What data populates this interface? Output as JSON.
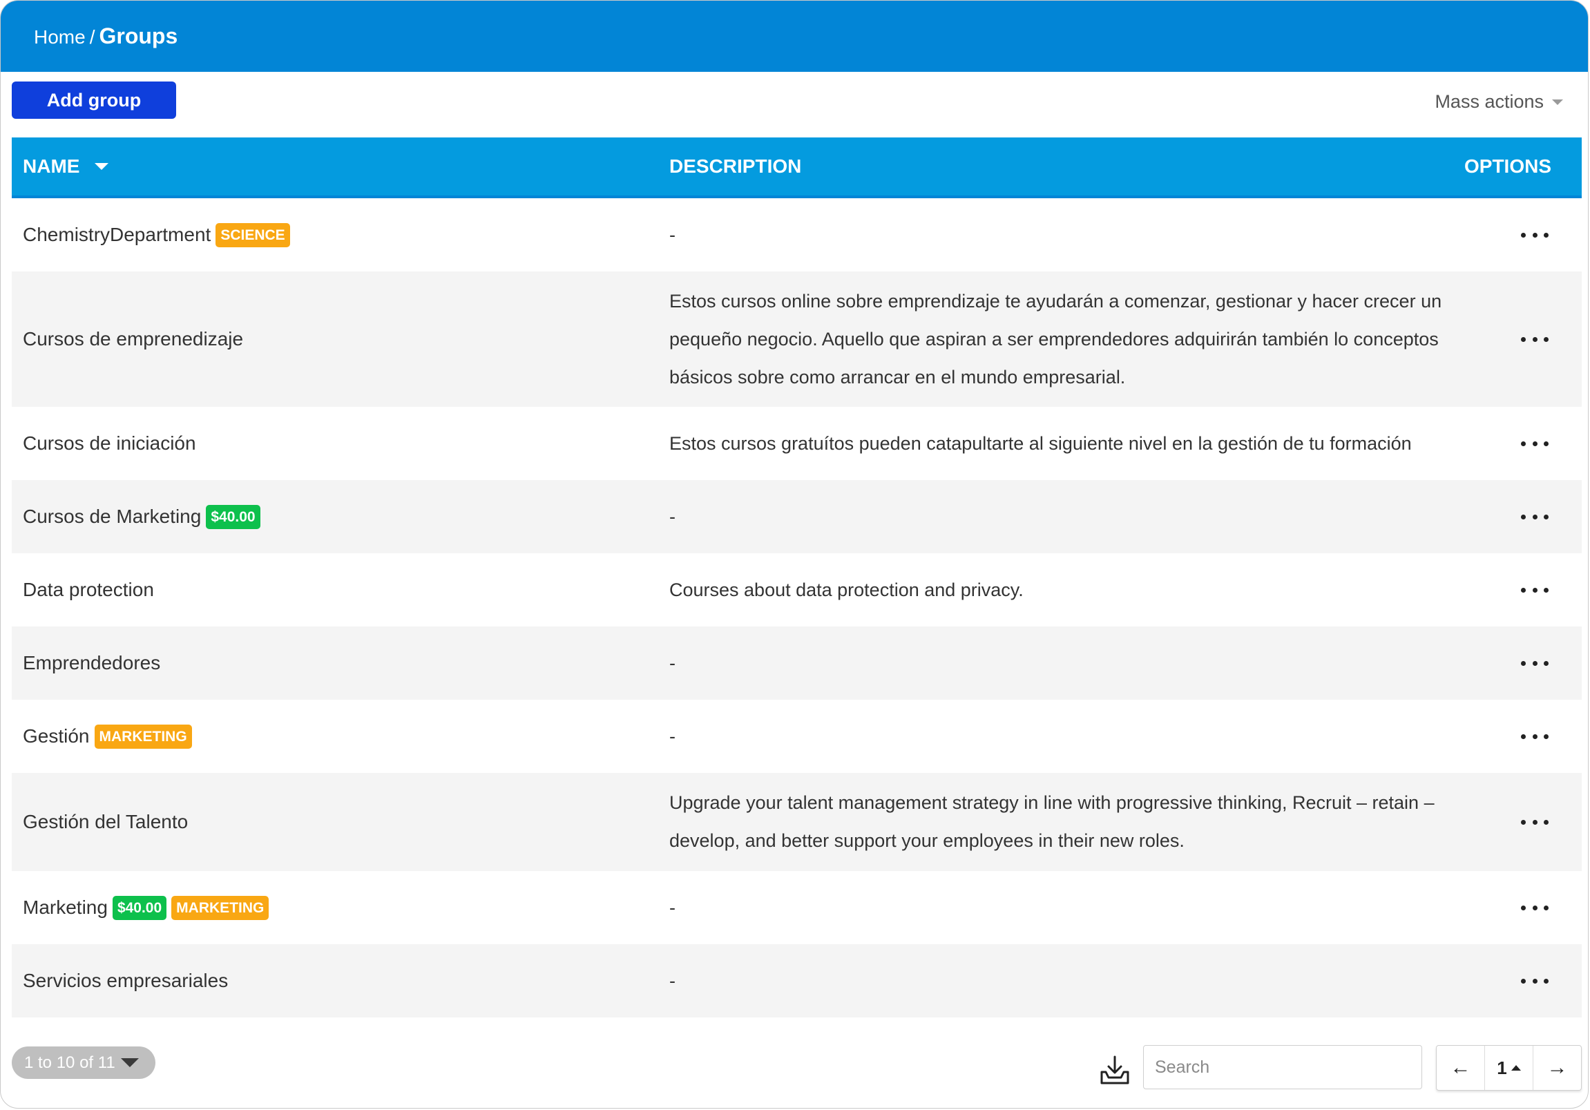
{
  "breadcrumb": {
    "home": "Home",
    "separator": "/",
    "current": "Groups"
  },
  "toolbar": {
    "add_label": "Add group",
    "mass_actions": "Mass actions"
  },
  "table": {
    "columns": {
      "name": "NAME",
      "description": "DESCRIPTION",
      "options": "OPTIONS"
    },
    "rows": [
      {
        "name": "ChemistryDepartment",
        "badges": [
          {
            "text": "SCIENCE",
            "color": "orange"
          }
        ],
        "description": "-"
      },
      {
        "name": "Cursos de emprenedizaje",
        "badges": [],
        "description": "Estos cursos online sobre emprendizaje te ayudarán a comenzar, gestionar y hacer crecer un pequeño negocio. Aquello que aspiran a ser emprendedores adquirirán también lo conceptos básicos sobre como arrancar en el mundo empresarial."
      },
      {
        "name": "Cursos de iniciación",
        "badges": [],
        "description": "Estos cursos gratuítos pueden catapultarte al siguiente nivel en la gestión de tu formación"
      },
      {
        "name": "Cursos de Marketing",
        "badges": [
          {
            "text": "$40.00",
            "color": "green"
          }
        ],
        "description": "-"
      },
      {
        "name": "Data protection",
        "badges": [],
        "description": "Courses about data protection and privacy."
      },
      {
        "name": "Emprendedores",
        "badges": [],
        "description": "-"
      },
      {
        "name": "Gestión",
        "badges": [
          {
            "text": "MARKETING",
            "color": "orange"
          }
        ],
        "description": "-"
      },
      {
        "name": "Gestión del Talento",
        "badges": [],
        "description": "Upgrade your talent management strategy in line with progressive thinking, Recruit – retain – develop, and better support your employees in their new roles."
      },
      {
        "name": "Marketing",
        "badges": [
          {
            "text": "$40.00",
            "color": "green"
          },
          {
            "text": "MARKETING",
            "color": "orange"
          }
        ],
        "description": "-"
      },
      {
        "name": "Servicios empresariales",
        "badges": [],
        "description": "-"
      }
    ]
  },
  "footer": {
    "count_label": "1 to 10 of 11",
    "search_placeholder": "Search",
    "prev": "←",
    "page": "1",
    "next": "→"
  },
  "colors": {
    "topbar": "#0285d6",
    "header": "#049bdf",
    "primary_button": "#0f3fdc",
    "badge_orange": "#f9a713",
    "badge_green": "#0dc04c"
  },
  "icons": {
    "export": "download-tray-icon",
    "options": "more-horizontal-icon",
    "sort": "caret-down-icon"
  }
}
